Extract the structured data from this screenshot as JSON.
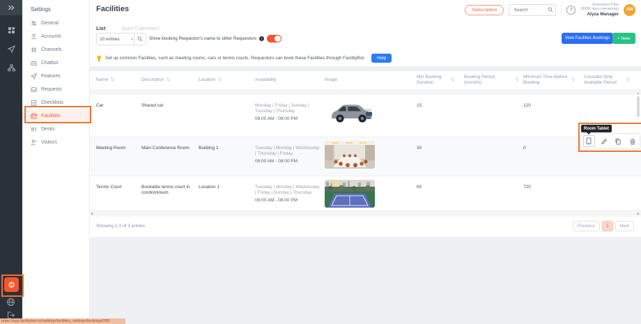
{
  "colors": {
    "accent_orange": "#f4572e",
    "annotation_orange": "#e8772e",
    "primary_blue": "#2b6ef5",
    "success_green": "#27c285",
    "rail_background": "#2a313b"
  },
  "rail": {
    "top_icon": "collapse-icon",
    "nav_icons": [
      "apps-icon",
      "paper-plane-icon",
      "sitemap-icon"
    ],
    "bottom_icons": [
      "settings-gear-icon",
      "globe-icon",
      "logout-icon"
    ],
    "status_url": "https://app.facilitybot.co/settings/facilities_settings/bookings/293"
  },
  "sidebar": {
    "title": "Settings",
    "items": [
      {
        "label": "General",
        "icon": "sliders-icon"
      },
      {
        "label": "Accounts",
        "icon": "user-icon"
      },
      {
        "label": "Channels",
        "icon": "channels-icon"
      },
      {
        "label": "Chatbot",
        "icon": "chatbot-icon"
      },
      {
        "label": "Features",
        "icon": "paper-plane-icon"
      },
      {
        "label": "Requests",
        "icon": "inbox-icon"
      },
      {
        "label": "Checklists",
        "icon": "checklist-icon"
      },
      {
        "label": "Facilities",
        "icon": "facilities-icon"
      },
      {
        "label": "Desks",
        "icon": "desk-icon"
      },
      {
        "label": "Visitors",
        "icon": "visitor-icon"
      }
    ]
  },
  "header": {
    "title": "Facilities",
    "subscription": "Subscription",
    "search_placeholder": "Search",
    "plan_name": "Enterprise Plan",
    "plan_days": "(9999 days remaining)",
    "user_name": "Alyza Manager",
    "avatar_initials": "AM"
  },
  "tabs": {
    "list": "List",
    "sync": "Sync Calendars"
  },
  "toolbar": {
    "entries": "10 entries",
    "toggle_label": "Show booking Requestor's name to other Requestors",
    "view_bookings": "View Facilities Bookings",
    "new": "+ New"
  },
  "tip": {
    "text": "Set up common Facilities, such as meeting rooms, cars or tennis courts. Requestors can book these Facilities through FacilityBot.",
    "help": "Help"
  },
  "table": {
    "columns": [
      "Name",
      "Description",
      "Location",
      "Availability",
      "Image",
      "Min Booking Duration",
      "Booking Period (months)",
      "Minimum Time Before Booking",
      "Consider Only Available Period"
    ],
    "rows": [
      {
        "name": "Car",
        "description": "Shared car",
        "location": "",
        "days": "Monday | Friday | Sunday | Tuesday | Thursday:",
        "time": "08:00 AM - 08:00 PM",
        "image": "car-photo",
        "min_booking_duration": "15",
        "booking_period": "",
        "min_time_before_booking": "120",
        "consider_only_available_period": ""
      },
      {
        "name": "Meeting Room",
        "description": "Main Conference Room",
        "location": "Building 1",
        "days": "Tuesday | Monday | Wednesday | Thursday | Friday:",
        "time": "08:00 AM - 08:00 PM",
        "image": "meeting-room-photo",
        "min_booking_duration": "30",
        "booking_period": "",
        "min_time_before_booking": "0",
        "consider_only_available_period": ""
      },
      {
        "name": "Tennis Court",
        "description": "Bookable tennis court in condominium",
        "location": "Location 1",
        "days": "Tuesday | Monday | Wednesday | Friday | Sunday | Thursday:",
        "time": "08:00 AM - 08:00 PM",
        "image": "tennis-court-photo",
        "min_booking_duration": "60",
        "booking_period": "",
        "min_time_before_booking": "720",
        "consider_only_available_period": ""
      }
    ]
  },
  "actions_tooltip": {
    "label": "Room Tablet",
    "icons": [
      "tablet-icon",
      "edit-icon",
      "copy-icon",
      "delete-icon"
    ]
  },
  "footer": {
    "showing": "Showing 1-3 of 3 entries",
    "previous": "Previous",
    "page": "1",
    "next": "Next"
  }
}
